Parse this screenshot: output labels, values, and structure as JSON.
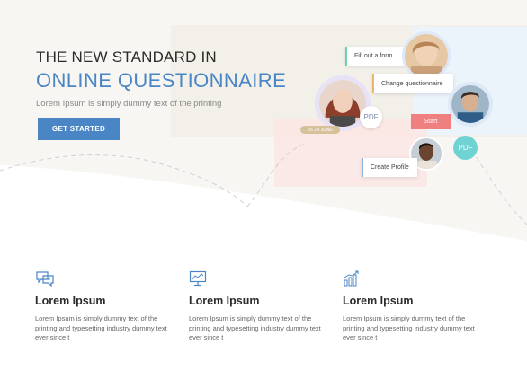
{
  "hero": {
    "title": "THE NEW STANDARD IN",
    "title_accent": "ONLINE QUESTIONNAIRE",
    "subtitle": "Lorem Ipsum is simply dummy text of the printing",
    "cta_label": "GET STARTED"
  },
  "illustration": {
    "fill_form_label": "Fill out a form",
    "change_questionnaire_label": "Change questionnaire",
    "start_label": "Start",
    "create_profile_label": "Create Profile",
    "pdf_label_1": "PDF",
    "pdf_label_2": "PDF",
    "date_pill": "25 JN JUNE"
  },
  "features": [
    {
      "icon": "chat-bubbles-icon",
      "title": "Lorem Ipsum",
      "text": "Lorem Ipsum is simply dummy text of the printing and typesetting industry dummy text ever since t"
    },
    {
      "icon": "monitor-chart-icon",
      "title": "Lorem Ipsum",
      "text": "Lorem Ipsum is simply dummy text of the printing and typesetting industry dummy text ever since t"
    },
    {
      "icon": "bar-chart-icon",
      "title": "Lorem Ipsum",
      "text": "Lorem Ipsum is simply dummy text of the printing and typesetting industry dummy text ever since t"
    }
  ],
  "colors": {
    "accent": "#4a86c5",
    "coral": "#f07f7f",
    "teal": "#6fd3d3",
    "tan": "#d6c29a",
    "hero_bg": "#f7f5f2"
  }
}
